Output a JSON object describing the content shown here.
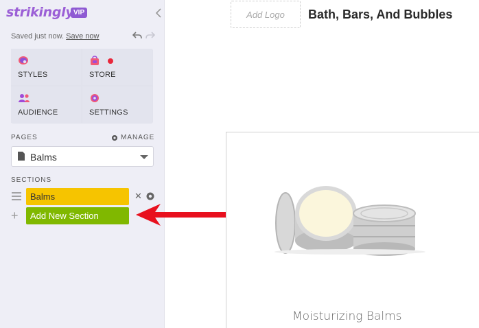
{
  "brand": {
    "logo": "strikingly",
    "badge": "VIP"
  },
  "status": {
    "saved_text": "Saved just now.",
    "save_link": "Save now"
  },
  "menu": [
    {
      "label": "STYLES",
      "icon": "palette-icon"
    },
    {
      "label": "STORE",
      "icon": "shopping-bag-icon"
    },
    {
      "label": "AUDIENCE",
      "icon": "people-icon"
    },
    {
      "label": "SETTINGS",
      "icon": "gear-icon"
    }
  ],
  "pages": {
    "label": "PAGES",
    "manage_label": "MANAGE",
    "selected": "Balms"
  },
  "sections": {
    "label": "SECTIONS",
    "items": [
      {
        "label": "Balms"
      }
    ],
    "add_label": "Add New Section"
  },
  "site": {
    "add_logo": "Add Logo",
    "title": "Bath, Bars, And Bubbles"
  },
  "product": {
    "caption": "Moisturizing Balms"
  },
  "colors": {
    "brand": "#9b5fd6",
    "section_active": "#f6c400",
    "add_section": "#80b800",
    "arrow": "#e8101e",
    "store_dot": "#e8273b"
  }
}
